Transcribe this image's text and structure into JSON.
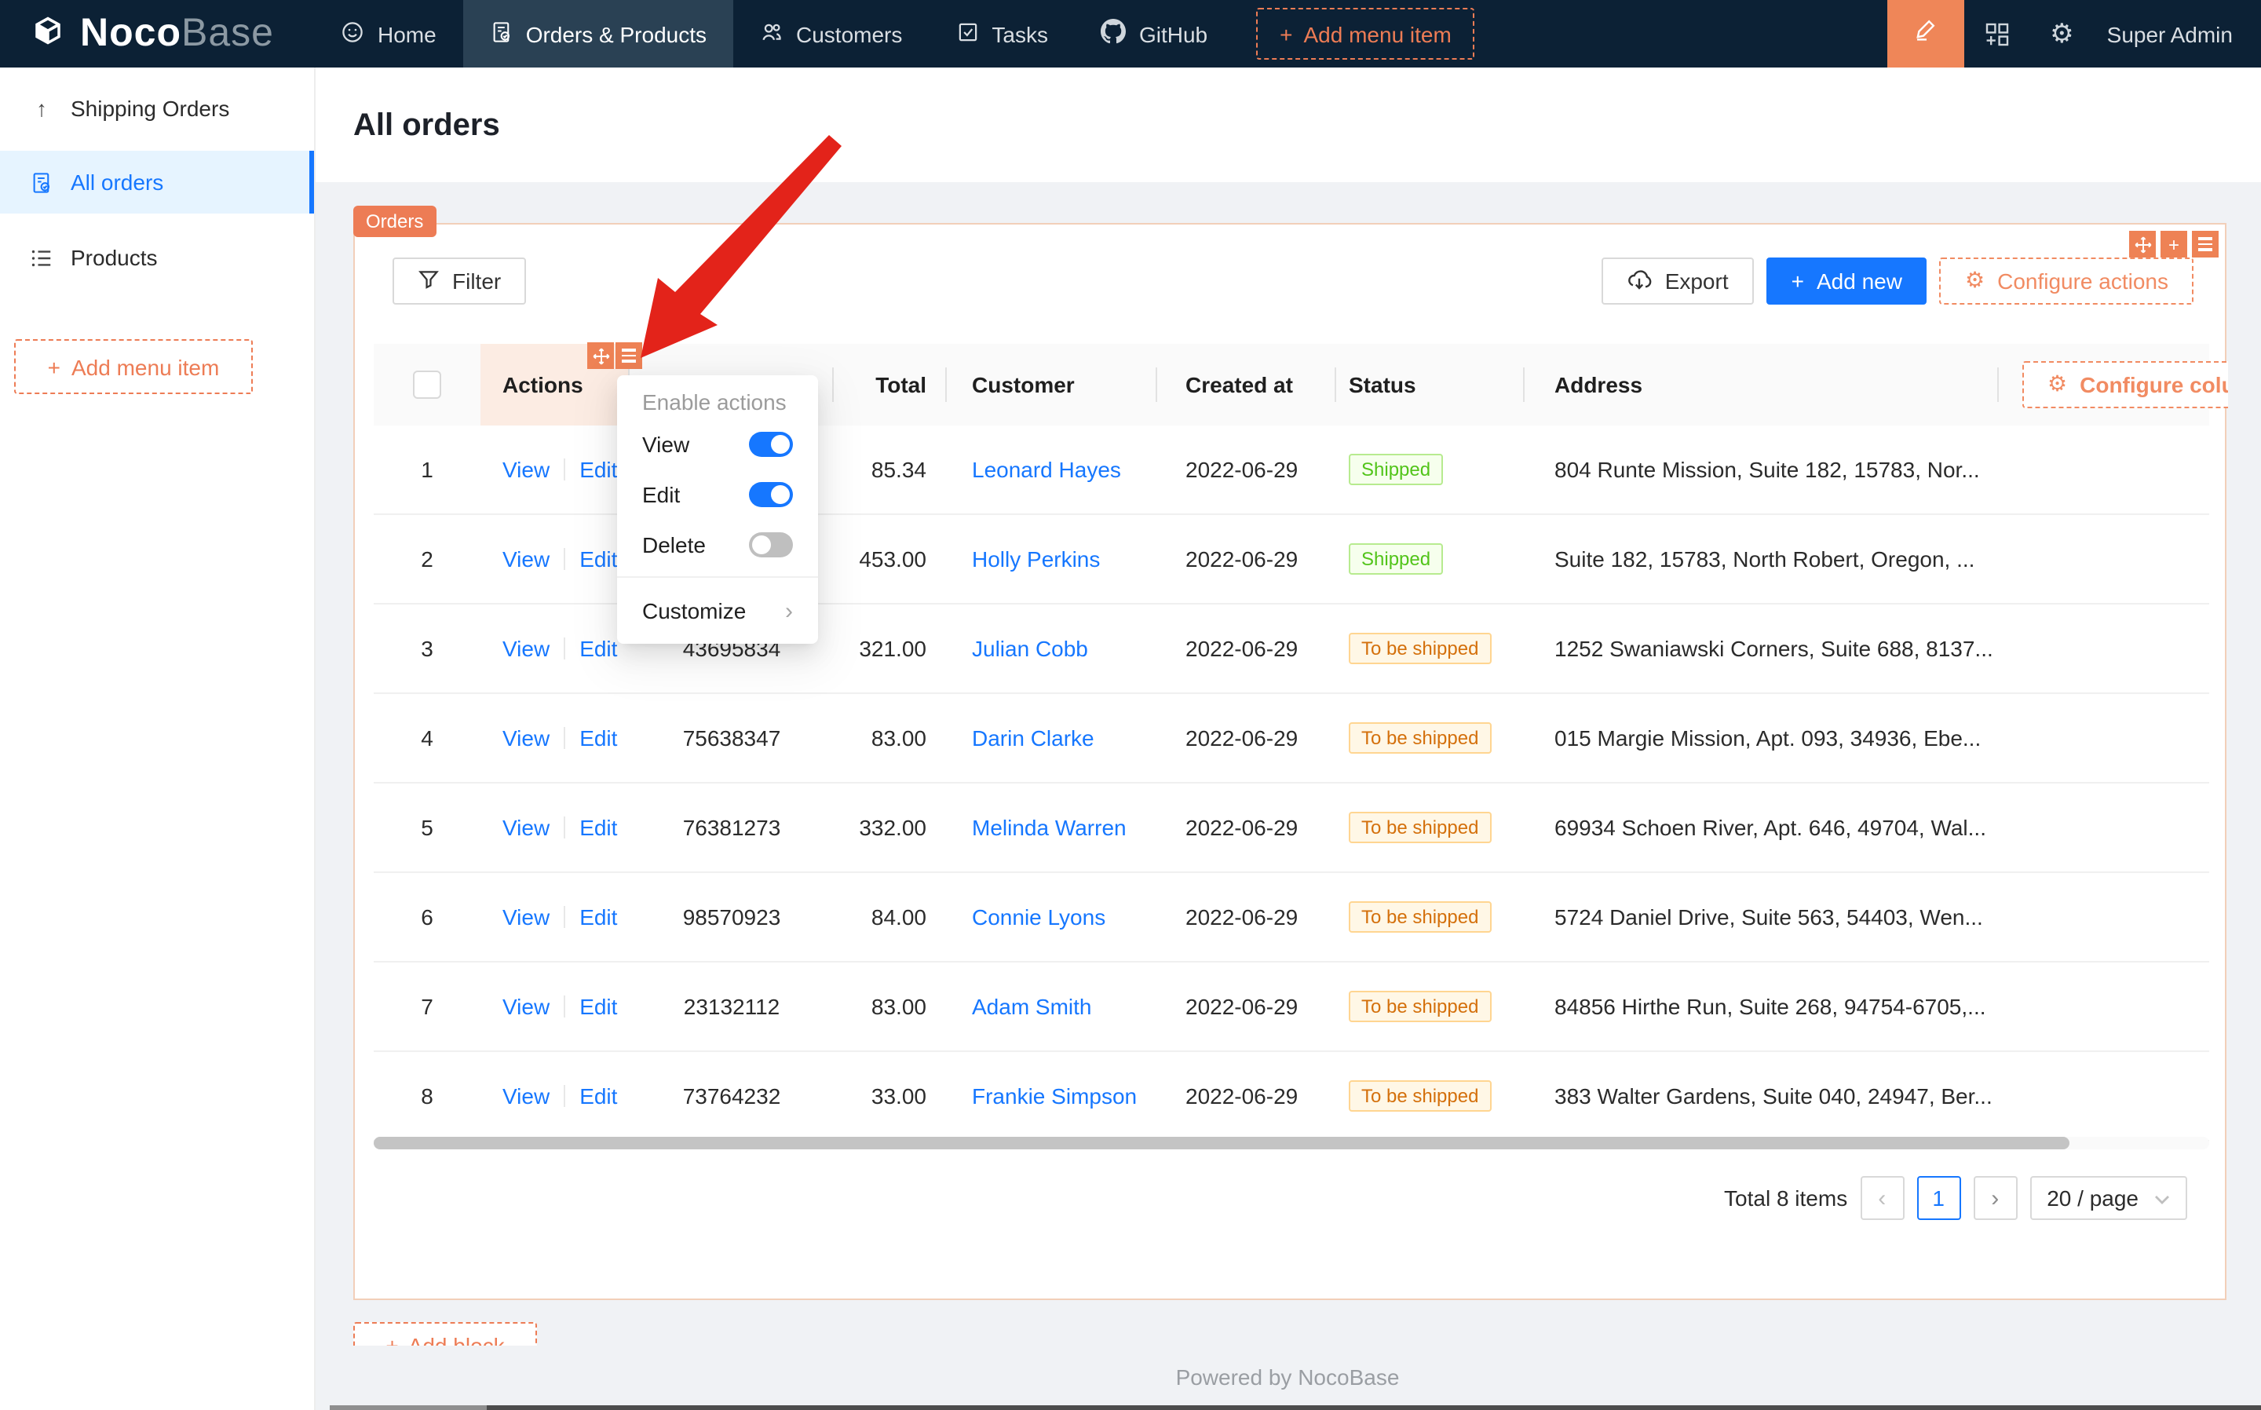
{
  "navbar": {
    "brand": {
      "bold": "Noco",
      "light": "Base"
    },
    "items": [
      {
        "label": "Home"
      },
      {
        "label": "Orders & Products"
      },
      {
        "label": "Customers"
      },
      {
        "label": "Tasks"
      },
      {
        "label": "GitHub"
      }
    ],
    "add_menu_item": "Add menu item",
    "user": "Super Admin"
  },
  "sidebar": {
    "items": [
      {
        "label": "Shipping Orders"
      },
      {
        "label": "All orders"
      },
      {
        "label": "Products"
      }
    ],
    "add_menu_item": "Add menu item"
  },
  "page": {
    "title": "All orders",
    "footer": "Powered by NocoBase",
    "add_block": "Add block"
  },
  "block": {
    "tag": "Orders",
    "filter": "Filter",
    "export": "Export",
    "add_new": "Add new",
    "configure_actions": "Configure actions",
    "configure_columns": "Configure columns"
  },
  "dropdown": {
    "title": "Enable actions",
    "items": [
      {
        "label": "View",
        "on": true
      },
      {
        "label": "Edit",
        "on": true
      },
      {
        "label": "Delete",
        "on": false
      }
    ],
    "customize": "Customize"
  },
  "table": {
    "headers": {
      "actions": "Actions",
      "total": "Total",
      "customer": "Customer",
      "created_at": "Created at",
      "status": "Status",
      "address": "Address"
    },
    "action_labels": {
      "view": "View",
      "edit": "Edit"
    },
    "rows": [
      {
        "no": "1",
        "order_no": "",
        "total": "85.34",
        "customer": "Leonard Hayes",
        "created_at": "2022-06-29",
        "status": "Shipped",
        "address": "804 Runte Mission, Suite 182, 15783, Nor..."
      },
      {
        "no": "2",
        "order_no": "",
        "total": "453.00",
        "customer": "Holly Perkins",
        "created_at": "2022-06-29",
        "status": "Shipped",
        "address": "Suite 182, 15783, North Robert, Oregon, ..."
      },
      {
        "no": "3",
        "order_no": "43695834",
        "total": "321.00",
        "customer": "Julian Cobb",
        "created_at": "2022-06-29",
        "status": "To be shipped",
        "address": "1252 Swaniawski Corners, Suite 688, 8137..."
      },
      {
        "no": "4",
        "order_no": "75638347",
        "total": "83.00",
        "customer": "Darin Clarke",
        "created_at": "2022-06-29",
        "status": "To be shipped",
        "address": "015 Margie Mission, Apt. 093, 34936, Ebe..."
      },
      {
        "no": "5",
        "order_no": "76381273",
        "total": "332.00",
        "customer": "Melinda Warren",
        "created_at": "2022-06-29",
        "status": "To be shipped",
        "address": "69934 Schoen River, Apt. 646, 49704, Wal..."
      },
      {
        "no": "6",
        "order_no": "98570923",
        "total": "84.00",
        "customer": "Connie Lyons",
        "created_at": "2022-06-29",
        "status": "To be shipped",
        "address": "5724 Daniel Drive, Suite 563, 54403, Wen..."
      },
      {
        "no": "7",
        "order_no": "23132112",
        "total": "83.00",
        "customer": "Adam Smith",
        "created_at": "2022-06-29",
        "status": "To be shipped",
        "address": "84856 Hirthe Run, Suite 268, 94754-6705,..."
      },
      {
        "no": "8",
        "order_no": "73764232",
        "total": "33.00",
        "customer": "Frankie Simpson",
        "created_at": "2022-06-29",
        "status": "To be shipped",
        "address": "383 Walter Gardens, Suite 040, 24947, Ber..."
      }
    ]
  },
  "pagination": {
    "total": "Total 8 items",
    "page": "1",
    "page_size": "20 / page"
  },
  "colors": {
    "navbar_bg": "#0c2135",
    "accent_orange": "#ed7c55",
    "primary_blue": "#1677ff",
    "status_green": "#52c41a",
    "status_orange": "#d4700c",
    "arrow_red": "#e3231a"
  }
}
